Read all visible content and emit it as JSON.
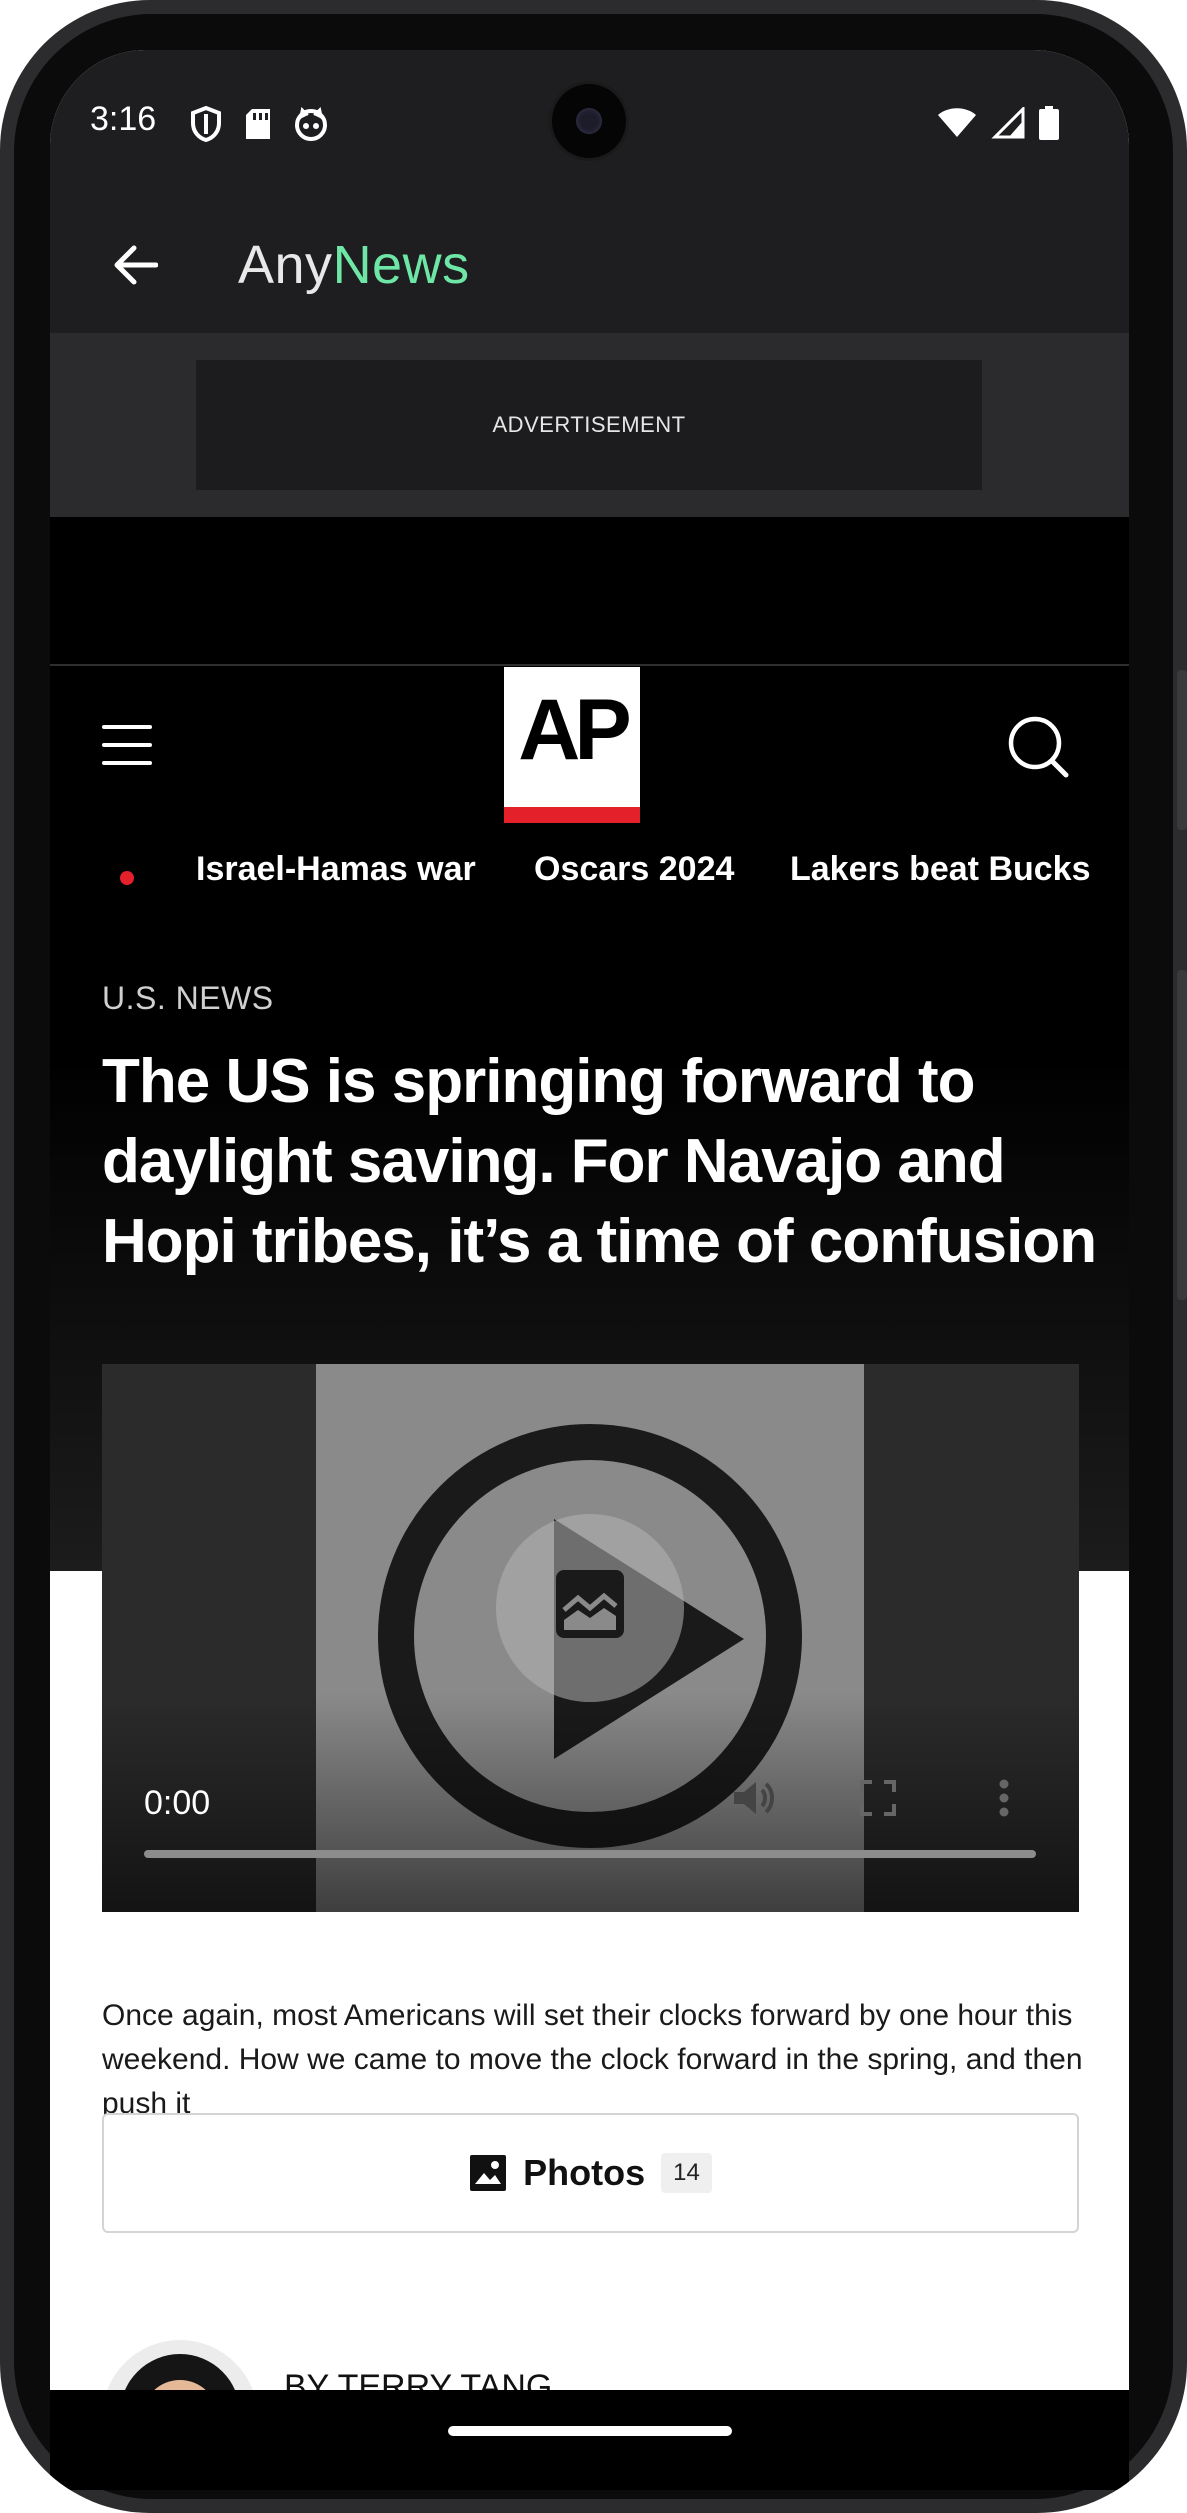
{
  "status_bar": {
    "time": "3:16",
    "left_icons": [
      "shield-icon",
      "sd-card-icon",
      "cat-face-icon"
    ],
    "right_icons": [
      "wifi-icon",
      "signal-icon",
      "battery-icon"
    ]
  },
  "app_bar": {
    "title_part1": "Any",
    "title_part2": "News",
    "accent_color": "#6ee7a6"
  },
  "advertisement": {
    "label": "ADVERTISEMENT"
  },
  "site_header": {
    "logo_text": "AP",
    "logo_accent_color": "#e4202b",
    "topics": [
      "Israel-Hamas war",
      "Oscars 2024",
      "Lakers beat Bucks"
    ]
  },
  "article": {
    "section": "U.S. NEWS",
    "headline": "The US is springing forward to daylight saving. For Navajo and Hopi tribes, it’s a time of confusion",
    "video": {
      "time": "0:00",
      "progress": 0
    },
    "summary": "Once again, most Americans will set their clocks forward by one hour this weekend. How we came to move the clock forward in the spring, and then push it",
    "photos_label": "Photos",
    "photos_count": "14",
    "byline_prefix": "BY ",
    "author": "TERRY TANG"
  }
}
